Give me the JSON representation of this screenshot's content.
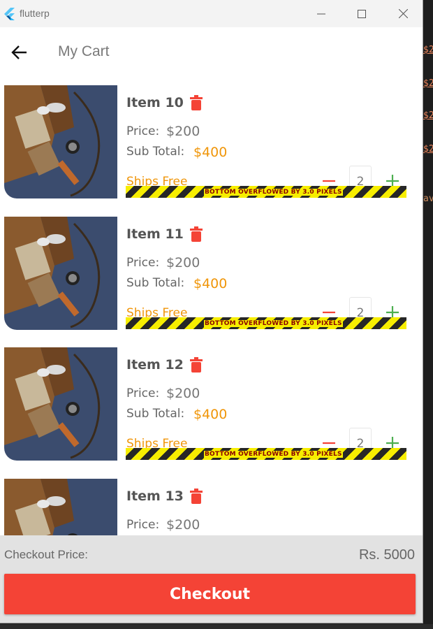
{
  "window": {
    "app_name": "flutterp"
  },
  "background_editor": {
    "fragments": [
      "$2",
      "$2",
      "$2",
      "$2",
      "av"
    ]
  },
  "appbar": {
    "title": "My Cart"
  },
  "cart": {
    "items": [
      {
        "title": "Item 10",
        "price_label": "Price:",
        "price": "$200",
        "subtotal_label": "Sub Total:",
        "subtotal": "$400",
        "shipping": "Ships Free",
        "quantity": "2",
        "overflow_message": "BOTTOM OVERFLOWED BY 3.0 PIXELS"
      },
      {
        "title": "Item 11",
        "price_label": "Price:",
        "price": "$200",
        "subtotal_label": "Sub Total:",
        "subtotal": "$400",
        "shipping": "Ships Free",
        "quantity": "2",
        "overflow_message": "BOTTOM OVERFLOWED BY 3.0 PIXELS"
      },
      {
        "title": "Item 12",
        "price_label": "Price:",
        "price": "$200",
        "subtotal_label": "Sub Total:",
        "subtotal": "$400",
        "shipping": "Ships Free",
        "quantity": "2",
        "overflow_message": "BOTTOM OVERFLOWED BY 3.0 PIXELS"
      },
      {
        "title": "Item 13",
        "price_label": "Price:",
        "price": "$200"
      }
    ]
  },
  "footer": {
    "checkout_label": "Checkout Price:",
    "checkout_price": "Rs. 5000",
    "checkout_button": "Checkout"
  },
  "colors": {
    "accent_orange": "#f0960a",
    "delete_red": "#f44336",
    "plus_green": "#4caf50",
    "checkout_red": "#f44336"
  },
  "icons": {
    "back": "arrow-back-icon",
    "delete": "trash-icon",
    "decrement": "minus-icon",
    "increment": "plus-icon"
  }
}
